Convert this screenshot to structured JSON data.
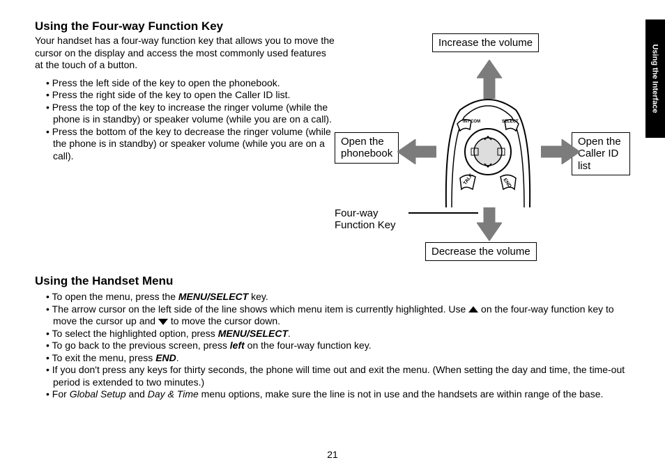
{
  "sideTab": "Using the Interface",
  "section1": {
    "heading": "Using the Four-way Function Key",
    "intro": "Your handset has a four-way function key that allows you to move the cursor on the display and access the most commonly used features at the touch of a button.",
    "bullets": [
      "Press the left side of the key to open the phonebook.",
      "Press the right side of the key to open the Caller ID list.",
      "Press the top of the key to increase the ringer volume (while the phone is in standby) or speaker volume (while you are on a call).",
      "Press the bottom of the key to decrease the ringer volume (while the phone is in standby) or speaker volume (while you are on a call)."
    ]
  },
  "diagram": {
    "top": "Increase the volume",
    "left_l1": "Open the",
    "left_l2": "phonebook",
    "right_l1": "Open the",
    "right_l2": "Caller ID list",
    "bottom": "Decrease the volume",
    "fw_l1": "Four-way",
    "fw_l2": "Function Key",
    "phone_intcom": "INT'COM",
    "phone_select": "SELECT",
    "phone_talk": "TALK",
    "phone_end": "END"
  },
  "section2": {
    "heading": "Using the Handset Menu",
    "b1a": "To open the menu, press the ",
    "b1b": "MENU/SELECT",
    "b1c": " key.",
    "b2a": "The arrow cursor on the left side of the line shows which menu item is currently highlighted. Use ",
    "b2b": " on the four-way function key to move the cursor up and ",
    "b2c": " to move the cursor down.",
    "b3a": "To select the highlighted option, press ",
    "b3b": "MENU/SELECT",
    "b3c": ".",
    "b4a": "To go back to the previous screen, press ",
    "b4b": "left",
    "b4c": " on the four-way function key.",
    "b5a": "To exit the menu, press ",
    "b5b": "END",
    "b5c": ".",
    "b6": "If you don't press any keys for thirty seconds, the phone will time out and exit the menu. (When setting the day and time, the time-out period is extended to two minutes.)",
    "b7a": "For ",
    "b7b": "Global Setup",
    "b7c": " and ",
    "b7d": "Day & Time",
    "b7e": " menu options, make sure the line is not in use and the handsets are within range of the base."
  },
  "pageNumber": "21"
}
